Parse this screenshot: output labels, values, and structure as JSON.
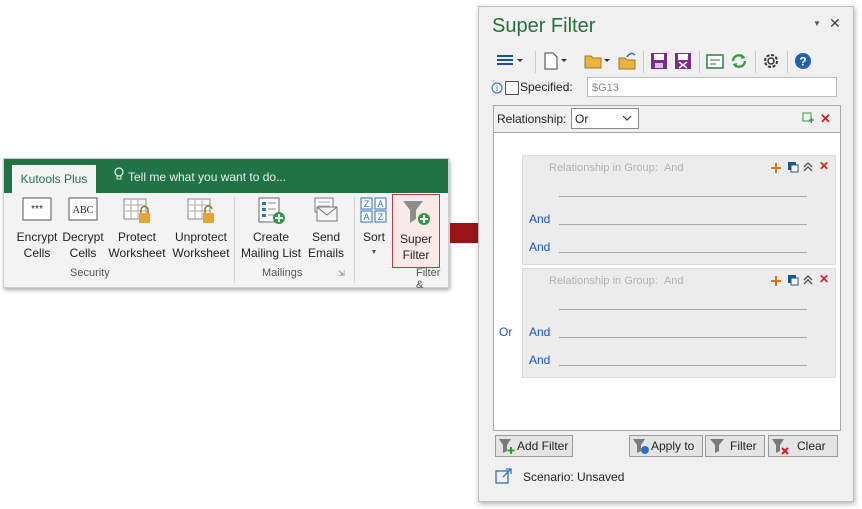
{
  "ribbon": {
    "tab_label": "Kutools Plus",
    "tell_me": "Tell me what you want to do...",
    "buttons": [
      {
        "label_line1": "Encrypt",
        "label_line2": "Cells",
        "icon": "encrypt-cells-icon"
      },
      {
        "label_line1": "Decrypt",
        "label_line2": "Cells",
        "icon": "decrypt-cells-icon"
      },
      {
        "label_line1": "Protect",
        "label_line2": "Worksheet",
        "icon": "protect-worksheet-icon"
      },
      {
        "label_line1": "Unprotect",
        "label_line2": "Worksheet",
        "icon": "unprotect-worksheet-icon"
      },
      {
        "label_line1": "Create",
        "label_line2": "Mailing List",
        "icon": "mailing-list-icon"
      },
      {
        "label_line1": "Send",
        "label_line2": "Emails",
        "icon": "send-emails-icon"
      },
      {
        "label_line1": "Sort",
        "label_line2": "",
        "icon": "sort-icon"
      },
      {
        "label_line1": "Super",
        "label_line2": "Filter",
        "icon": "super-filter-icon"
      }
    ],
    "groups": [
      "Security",
      "Mailings",
      "Filter &"
    ],
    "encrypt_glyph": "***",
    "decrypt_glyph": "ABC"
  },
  "panel": {
    "title": "Super Filter",
    "specified_label": "Specified:",
    "specified_checked": false,
    "range_value": "$G13",
    "relationship_label": "Relationship:",
    "relationship_value": "Or",
    "outer_connector": "Or",
    "groups": [
      {
        "header": "Relationship in Group:",
        "relation": "And",
        "rows": [
          "",
          "And",
          "And"
        ]
      },
      {
        "header": "Relationship in Group:",
        "relation": "And",
        "rows": [
          "",
          "And",
          "And"
        ]
      }
    ],
    "buttons": {
      "add_filter": "Add Filter",
      "apply_to": "Apply to",
      "filter": "Filter",
      "clear": "Clear"
    },
    "scenario_label": "Scenario:",
    "scenario_value": "Unsaved",
    "close_glyph": "✕",
    "dropdown_glyph": "▼",
    "colors": {
      "accent": "#217346",
      "link": "#1f4fd0",
      "delete": "#d21f1f",
      "arrow": "#9b1218"
    }
  }
}
